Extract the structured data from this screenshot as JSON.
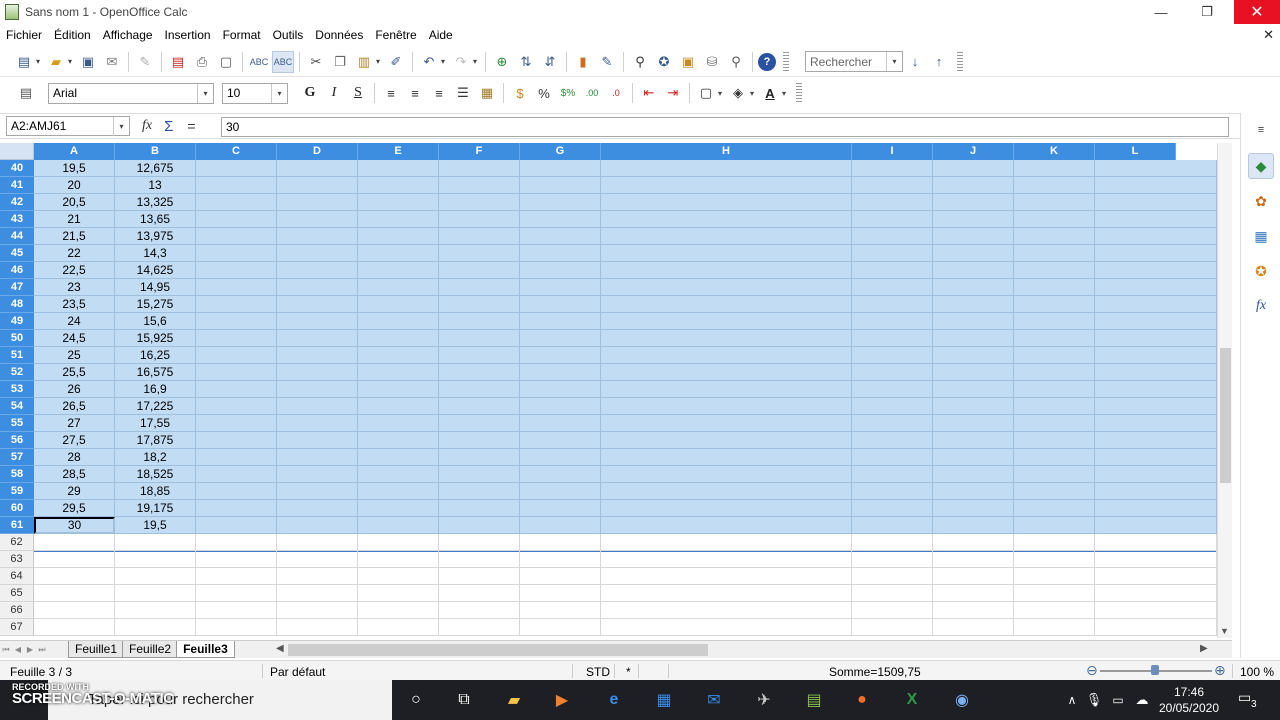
{
  "window": {
    "title": "Sans nom 1 - OpenOffice Calc",
    "minimize": "—",
    "maximize": "❐",
    "close": "✕"
  },
  "menu": {
    "items": [
      "Fichier",
      "Édition",
      "Affichage",
      "Insertion",
      "Format",
      "Outils",
      "Données",
      "Fenêtre",
      "Aide"
    ],
    "close_doc": "✕"
  },
  "toolbar": {
    "search_placeholder": "Rechercher"
  },
  "format_toolbar": {
    "font_name": "Arial",
    "font_size": "10",
    "bold": "G",
    "italic": "I",
    "underline": "S"
  },
  "formula_bar": {
    "name_box": "A2:AMJ61",
    "fx": "fx",
    "sigma": "Σ",
    "equals": "=",
    "content": "30"
  },
  "columns": [
    "A",
    "B",
    "C",
    "D",
    "E",
    "F",
    "G",
    "H",
    "I",
    "J",
    "K",
    "L"
  ],
  "rows": [
    {
      "n": "40",
      "a": "19,5",
      "b": "12,675"
    },
    {
      "n": "41",
      "a": "20",
      "b": "13"
    },
    {
      "n": "42",
      "a": "20,5",
      "b": "13,325"
    },
    {
      "n": "43",
      "a": "21",
      "b": "13,65"
    },
    {
      "n": "44",
      "a": "21,5",
      "b": "13,975"
    },
    {
      "n": "45",
      "a": "22",
      "b": "14,3"
    },
    {
      "n": "46",
      "a": "22,5",
      "b": "14,625"
    },
    {
      "n": "47",
      "a": "23",
      "b": "14,95"
    },
    {
      "n": "48",
      "a": "23,5",
      "b": "15,275"
    },
    {
      "n": "49",
      "a": "24",
      "b": "15,6"
    },
    {
      "n": "50",
      "a": "24,5",
      "b": "15,925"
    },
    {
      "n": "51",
      "a": "25",
      "b": "16,25"
    },
    {
      "n": "52",
      "a": "25,5",
      "b": "16,575"
    },
    {
      "n": "53",
      "a": "26",
      "b": "16,9"
    },
    {
      "n": "54",
      "a": "26,5",
      "b": "17,225"
    },
    {
      "n": "55",
      "a": "27",
      "b": "17,55"
    },
    {
      "n": "56",
      "a": "27,5",
      "b": "17,875"
    },
    {
      "n": "57",
      "a": "28",
      "b": "18,2"
    },
    {
      "n": "58",
      "a": "28,5",
      "b": "18,525"
    },
    {
      "n": "59",
      "a": "29",
      "b": "18,85"
    },
    {
      "n": "60",
      "a": "29,5",
      "b": "19,175"
    },
    {
      "n": "61",
      "a": "30",
      "b": "19,5"
    }
  ],
  "empty_rows": [
    "62",
    "63",
    "64",
    "65",
    "66",
    "67"
  ],
  "sheets": {
    "tabs": [
      "Feuille1",
      "Feuille2",
      "Feuille3"
    ],
    "active": "Feuille3"
  },
  "status": {
    "sheet": "Feuille 3 / 3",
    "style": "Par défaut",
    "mode": "STD",
    "modified": "*",
    "sum": "Somme=1509,75",
    "zoom_minus": "⊖",
    "zoom_plus": "⊕",
    "zoom": "100 %"
  },
  "taskbar": {
    "search_text": "Taper ici pour rechercher",
    "watermark_top": "RECORDED WITH",
    "watermark_brand": "SCREENCAST-O-MATIC",
    "time": "17:46",
    "date": "20/05/2020",
    "notifications": "3"
  },
  "colors": {
    "selection": "#c2dcf4",
    "header_selected": "#3d8ee0",
    "close_red": "#e81123"
  }
}
